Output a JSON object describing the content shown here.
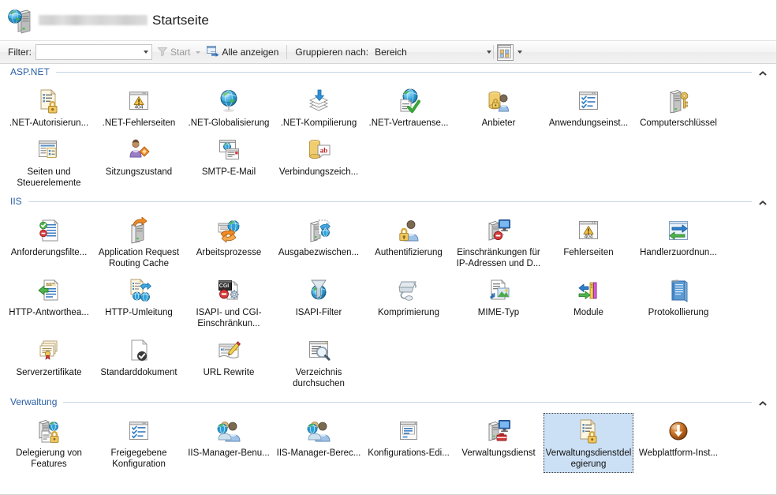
{
  "window": {
    "title_suffix": "Startseite",
    "server_name_redacted": true,
    "title_icon": "server-globe-icon"
  },
  "toolbar": {
    "filter_label": "Filter:",
    "filter_value": "",
    "filter_placeholder": "",
    "go_label": "Start",
    "go_enabled": false,
    "show_all_label": "Alle anzeigen",
    "group_by_label": "Gruppieren nach:",
    "group_by_value": "Bereich",
    "view_icon": "view-options-icon"
  },
  "sections": [
    {
      "id": "aspnet",
      "title": "ASP.NET",
      "collapse_icon": "chevron-up-icon",
      "items": [
        {
          "label": ".NET-Autorisierun...",
          "icon": "net-authorization-icon",
          "selected": false
        },
        {
          "label": ".NET-Fehlerseiten",
          "icon": "net-error-pages-icon",
          "selected": false
        },
        {
          "label": ".NET-Globalisierung",
          "icon": "net-globalization-icon",
          "selected": false
        },
        {
          "label": ".NET-Kompilierung",
          "icon": "net-compilation-icon",
          "selected": false
        },
        {
          "label": ".NET-Vertrauense...",
          "icon": "net-trust-levels-icon",
          "selected": false
        },
        {
          "label": "Anbieter",
          "icon": "providers-icon",
          "selected": false
        },
        {
          "label": "Anwendungseinst...",
          "icon": "application-settings-icon",
          "selected": false
        },
        {
          "label": "Computerschlüssel",
          "icon": "machine-key-icon",
          "selected": false
        },
        {
          "label": "Seiten und Steuerelemente",
          "icon": "pages-controls-icon",
          "selected": false
        },
        {
          "label": "Sitzungszustand",
          "icon": "session-state-icon",
          "selected": false
        },
        {
          "label": "SMTP-E-Mail",
          "icon": "smtp-email-icon",
          "selected": false
        },
        {
          "label": "Verbindungszeich...",
          "icon": "connection-strings-icon",
          "selected": false
        }
      ]
    },
    {
      "id": "iis",
      "title": "IIS",
      "collapse_icon": "chevron-up-icon",
      "items": [
        {
          "label": "Anforderungsfilte...",
          "icon": "request-filtering-icon",
          "selected": false
        },
        {
          "label": "Application Request Routing Cache",
          "icon": "arr-cache-icon",
          "selected": false
        },
        {
          "label": "Arbeitsprozesse",
          "icon": "worker-processes-icon",
          "selected": false
        },
        {
          "label": "Ausgabezwischen...",
          "icon": "output-caching-icon",
          "selected": false
        },
        {
          "label": "Authentifizierung",
          "icon": "authentication-icon",
          "selected": false
        },
        {
          "label": "Einschränkungen für IP-Adressen und D...",
          "icon": "ip-restrictions-icon",
          "selected": false
        },
        {
          "label": "Fehlerseiten",
          "icon": "error-pages-icon",
          "selected": false
        },
        {
          "label": "Handlerzuordnun...",
          "icon": "handler-mappings-icon",
          "selected": false
        },
        {
          "label": "HTTP-Antworthea...",
          "icon": "http-response-headers-icon",
          "selected": false
        },
        {
          "label": "HTTP-Umleitung",
          "icon": "http-redirect-icon",
          "selected": false
        },
        {
          "label": "ISAPI- und CGI-Einschränkun...",
          "icon": "isapi-cgi-restrictions-icon",
          "selected": false
        },
        {
          "label": "ISAPI-Filter",
          "icon": "isapi-filters-icon",
          "selected": false
        },
        {
          "label": "Komprimierung",
          "icon": "compression-icon",
          "selected": false
        },
        {
          "label": "MIME-Typ",
          "icon": "mime-types-icon",
          "selected": false
        },
        {
          "label": "Module",
          "icon": "modules-icon",
          "selected": false
        },
        {
          "label": "Protokollierung",
          "icon": "logging-icon",
          "selected": false
        },
        {
          "label": "Serverzertifikate",
          "icon": "server-certificates-icon",
          "selected": false
        },
        {
          "label": "Standarddokument",
          "icon": "default-document-icon",
          "selected": false
        },
        {
          "label": "URL Rewrite",
          "icon": "url-rewrite-icon",
          "selected": false
        },
        {
          "label": "Verzeichnis durchsuchen",
          "icon": "directory-browsing-icon",
          "selected": false
        }
      ]
    },
    {
      "id": "verwaltung",
      "title": "Verwaltung",
      "collapse_icon": "chevron-up-icon",
      "items": [
        {
          "label": "Delegierung von Features",
          "icon": "feature-delegation-icon",
          "selected": false
        },
        {
          "label": "Freigegebene Konfiguration",
          "icon": "shared-configuration-icon",
          "selected": false
        },
        {
          "label": "IIS-Manager-Benu...",
          "icon": "iis-manager-users-icon",
          "selected": false
        },
        {
          "label": "IIS-Manager-Berec...",
          "icon": "iis-manager-permissions-icon",
          "selected": false
        },
        {
          "label": "Konfigurations-Edi...",
          "icon": "configuration-editor-icon",
          "selected": false
        },
        {
          "label": "Verwaltungsdienst",
          "icon": "management-service-icon",
          "selected": false
        },
        {
          "label": "Verwaltungsdienstdelegierung",
          "icon": "management-service-delegation-icon",
          "selected": true
        },
        {
          "label": "Webplattform-Inst...",
          "icon": "web-platform-installer-icon",
          "selected": false
        }
      ]
    }
  ],
  "colors": {
    "section_title": "#2a5fa5",
    "selection_fill": "#cce0f5",
    "selection_border": "#3c3c3c",
    "toolbar_bg": "#f2f2f2"
  }
}
